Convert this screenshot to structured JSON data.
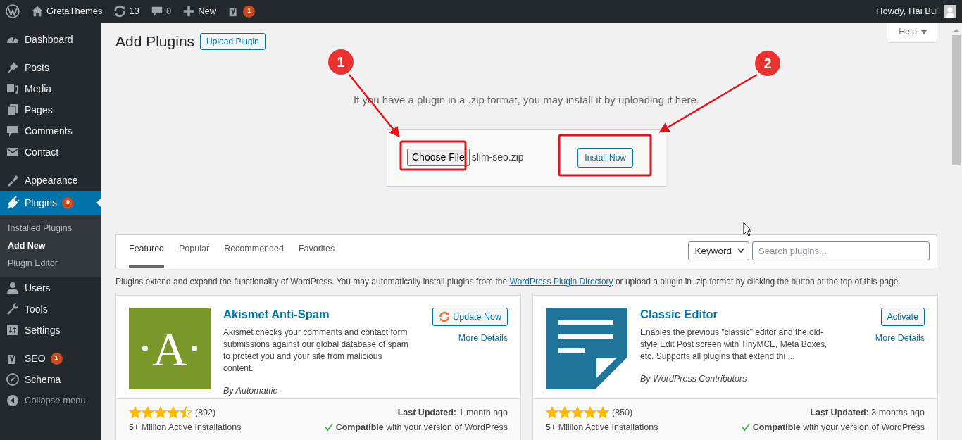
{
  "admin_bar": {
    "site_name": "GretaThemes",
    "updates": "13",
    "comments": "0",
    "new_label": "New",
    "seo_badge": "1",
    "greeting": "Howdy, Hai Bui"
  },
  "sidebar": {
    "groups": [
      [
        {
          "kind": "dashboard",
          "label": "Dashboard",
          "selected": false
        }
      ],
      [
        {
          "kind": "pin",
          "label": "Posts",
          "selected": false
        },
        {
          "kind": "media",
          "label": "Media",
          "selected": false
        },
        {
          "kind": "pages",
          "label": "Pages",
          "selected": false
        },
        {
          "kind": "comments",
          "label": "Comments",
          "selected": false
        },
        {
          "kind": "mail",
          "label": "Contact",
          "selected": false
        }
      ],
      [
        {
          "kind": "brush",
          "label": "Appearance",
          "selected": false
        },
        {
          "kind": "plug",
          "label": "Plugins",
          "selected": true,
          "badge": "9",
          "children": [
            {
              "label": "Installed Plugins",
              "selected": false
            },
            {
              "label": "Add New",
              "selected": true
            },
            {
              "label": "Plugin Editor",
              "selected": false
            }
          ]
        },
        {
          "kind": "user",
          "label": "Users",
          "selected": false
        },
        {
          "kind": "wrench",
          "label": "Tools",
          "selected": false
        },
        {
          "kind": "sliders",
          "label": "Settings",
          "selected": false
        }
      ],
      [
        {
          "kind": "yoast",
          "label": "SEO",
          "selected": false,
          "badge": "1"
        },
        {
          "kind": "compass",
          "label": "Schema",
          "selected": false
        }
      ]
    ],
    "collapse": "Collapse menu"
  },
  "page": {
    "title": "Add Plugins",
    "upload_button": "Upload Plugin",
    "help_tab": "Help"
  },
  "upload": {
    "instructions": "If you have a plugin in a .zip format, you may install it by uploading it here.",
    "choose_button": "Choose File",
    "file_name": "slim-seo.zip",
    "install_button": "Install Now"
  },
  "filter": {
    "tabs": [
      {
        "label": "Featured",
        "selected": true
      },
      {
        "label": "Popular",
        "selected": false
      },
      {
        "label": "Recommended",
        "selected": false
      },
      {
        "label": "Favorites",
        "selected": false
      }
    ],
    "search_type": "Keyword",
    "search_placeholder": "Search plugins..."
  },
  "intro": {
    "before": "Plugins extend and expand the functionality of WordPress. You may automatically install plugins from the ",
    "link": "WordPress Plugin Directory",
    "after": " or upload a plugin in .zip format by clicking the button at the top of this page."
  },
  "plugins": [
    {
      "kind": "akismet",
      "logo_text": "A",
      "name": "Akismet Anti-Spam",
      "description": "Akismet checks your comments and contact form submissions against our global database of spam to protect you and your site from malicious content.",
      "author_prefix": "By",
      "author": "Automattic",
      "action": {
        "kind": "update",
        "label": "Update Now"
      },
      "more": "More Details",
      "stars": 4.5,
      "ratings": "(892)",
      "last_updated": "**Last Updated:** 1 month ago",
      "installs": "5+ Million Active Installations",
      "compatibility": "**Compatible** with your version of WordPress"
    },
    {
      "kind": "document",
      "name": "Classic Editor",
      "description": "Enables the previous \"classic\" editor and the old-style Edit Post screen with TinyMCE, Meta Boxes, etc. Supports all plugins that extend thi ...",
      "author_prefix": "By",
      "author": "WordPress Contributors",
      "action": {
        "kind": "activate",
        "label": "Activate"
      },
      "more": "More Details",
      "stars": 5,
      "ratings": "(850)",
      "last_updated": "**Last Updated:** 3 months ago",
      "installs": "5+ Million Active Installations",
      "compatibility": "**Compatible** with your version of WordPress"
    }
  ],
  "annotations": [
    {
      "label": "1"
    },
    {
      "label": "2"
    }
  ]
}
